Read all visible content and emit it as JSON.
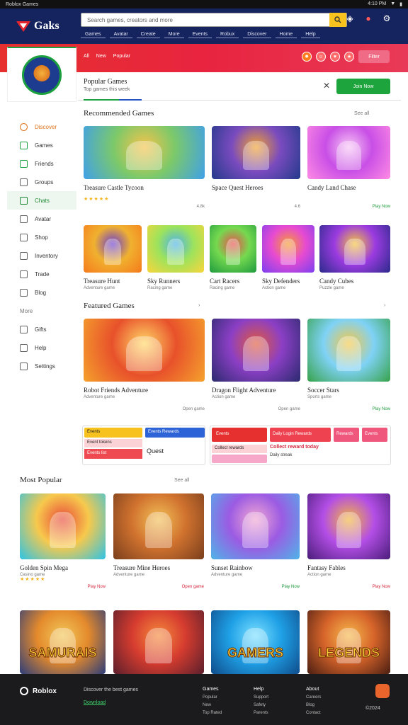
{
  "status": {
    "left": "Roblox Games",
    "right": "4:10 PM"
  },
  "brand": {
    "name": "Gaks"
  },
  "search": {
    "placeholder": "Search games, creators and more"
  },
  "nav": [
    "Games",
    "Avatar",
    "Create",
    "More",
    "Events",
    "Robux",
    "Discover",
    "Home",
    "Help"
  ],
  "redbar": {
    "tabs": [
      "All",
      "New",
      "Popular"
    ],
    "pill": "Filter"
  },
  "sidebar": {
    "items": [
      {
        "label": "Discover",
        "style": "orange"
      },
      {
        "label": "Games",
        "style": "green"
      },
      {
        "label": "Friends",
        "style": "green"
      },
      {
        "label": "Groups",
        "style": ""
      },
      {
        "label": "Chats",
        "style": "active"
      },
      {
        "label": "Avatar",
        "style": ""
      },
      {
        "label": "Shop",
        "style": ""
      },
      {
        "label": "Inventory",
        "style": ""
      },
      {
        "label": "Trade",
        "style": ""
      },
      {
        "label": "Blog",
        "style": ""
      },
      {
        "label": "More",
        "style": "plain"
      },
      {
        "label": "Gifts",
        "style": ""
      },
      {
        "label": "Help",
        "style": ""
      },
      {
        "label": "Settings",
        "style": ""
      }
    ]
  },
  "filter": {
    "title": "Popular Games",
    "subtitle": "Top games this week",
    "button": "Join Now"
  },
  "section1": {
    "title": "Recommended Games",
    "link": "See all",
    "cards": [
      {
        "title": "Treasure Castle Tycoon",
        "rating": "★★★★★",
        "meta": "4.8k"
      },
      {
        "title": "Space Quest Heroes",
        "rating": "",
        "meta": "4.6"
      },
      {
        "title": "Candy Land Chase",
        "rating": "",
        "meta": "Play Now"
      }
    ]
  },
  "section1b": {
    "cards": [
      {
        "title": "Treasure Hunt",
        "sub": "Adventure game"
      },
      {
        "title": "Sky Runners",
        "sub": "Racing game"
      },
      {
        "title": "Cart Racers",
        "sub": "Racing game"
      },
      {
        "title": "Sky Defenders",
        "sub": "Action game"
      },
      {
        "title": "Candy Cubes",
        "sub": "Puzzle game"
      }
    ]
  },
  "section2": {
    "title": "Featured Games",
    "cards": [
      {
        "title": "Robot Friends Adventure",
        "sub": "Adventure game",
        "meta": "Open game"
      },
      {
        "title": "Dragon Flight Adventure",
        "sub": "Action game",
        "meta": "Open game"
      },
      {
        "title": "Soccer Stars",
        "sub": "Sports game",
        "meta": "Play Now"
      }
    ]
  },
  "banners": {
    "b1": {
      "tab1": "Events",
      "tab2": "Events Rewards",
      "line1": "Event tokens",
      "line2": "Events list",
      "side": "Quest"
    },
    "b2": {
      "tab1": "Events",
      "tab2": "Daily Login Rewards",
      "tab3": "Rewards",
      "tab4": "Events",
      "line1": "Collect rewards",
      "line2": "Collect reward today",
      "line3": "Daily streak"
    }
  },
  "section3": {
    "title": "Most Popular",
    "link": "See all",
    "cards": [
      {
        "title": "Golden Spin Mega",
        "sub": "Casino game",
        "rating": "★★★★★",
        "meta": "Play Now"
      },
      {
        "title": "Treasure Mine Heroes",
        "sub": "Adventure game",
        "meta": "Open game"
      },
      {
        "title": "Sunset Rainbow",
        "sub": "Adventure game",
        "meta": "Play Now"
      },
      {
        "title": "Fantasy Fables",
        "sub": "Action game",
        "meta": "Play Now"
      }
    ]
  },
  "section4": {
    "cards": [
      {
        "label": "SAMURAIS"
      },
      {
        "label": ""
      },
      {
        "label": "GAMERS"
      },
      {
        "label": "LEGENDS"
      }
    ]
  },
  "footer": {
    "brand": "Roblox",
    "tagline": "Discover the best games",
    "link": "Download",
    "cols": [
      {
        "head": "Games",
        "items": [
          "Popular",
          "New",
          "Top Rated"
        ]
      },
      {
        "head": "Help",
        "items": [
          "Support",
          "Safety",
          "Parents"
        ]
      },
      {
        "head": "About",
        "items": [
          "Careers",
          "Blog",
          "Contact"
        ]
      }
    ],
    "copy": "©2024"
  },
  "colors": {
    "brand": "#15235e",
    "accent": "#e6302f",
    "green": "#1ea43c"
  }
}
